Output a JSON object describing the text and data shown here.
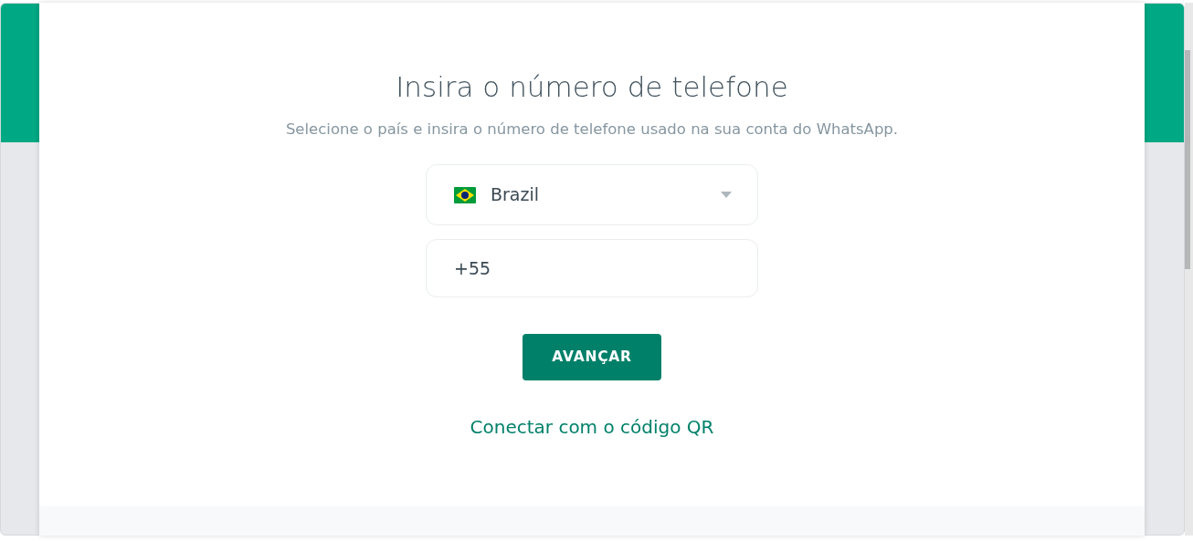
{
  "heading": "Insira o número de telefone",
  "subtitle": "Selecione o país e insira o número de telefone usado na sua conta do WhatsApp.",
  "country_select": {
    "value": "Brazil"
  },
  "phone_field": {
    "value": "+55"
  },
  "next_button": {
    "label": "AVANÇAR"
  },
  "qr_link": {
    "label": "Conectar com o código QR"
  }
}
